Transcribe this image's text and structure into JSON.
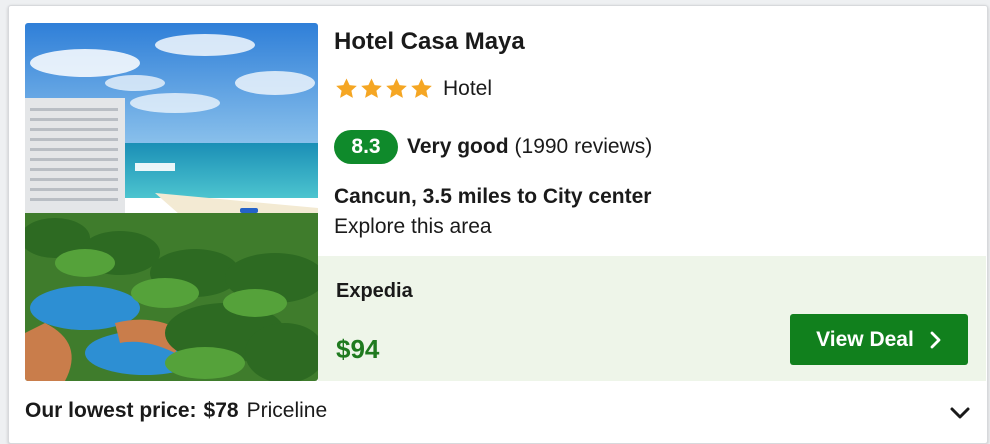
{
  "hotel": {
    "name": "Hotel Casa Maya",
    "stars": 4,
    "type": "Hotel",
    "score": "8.3",
    "rating_word": "Very good",
    "reviews": "(1990 reviews)",
    "location": "Cancun, 3.5 miles to City center",
    "explore": "Explore this area"
  },
  "deal": {
    "provider": "Expedia",
    "price": "$94",
    "button_label": "View Deal"
  },
  "footer": {
    "label": "Our lowest price:",
    "price": "$78",
    "provider": "Priceline"
  },
  "colors": {
    "score_badge": "#0f8a2b",
    "deal_panel": "#eef5e9",
    "price": "#1f7a1f",
    "button": "#11801d",
    "star": "#f5a623"
  },
  "icons": {
    "star": "star-icon",
    "button_chevron": "chevron-right-icon",
    "expand": "chevron-down-icon"
  }
}
